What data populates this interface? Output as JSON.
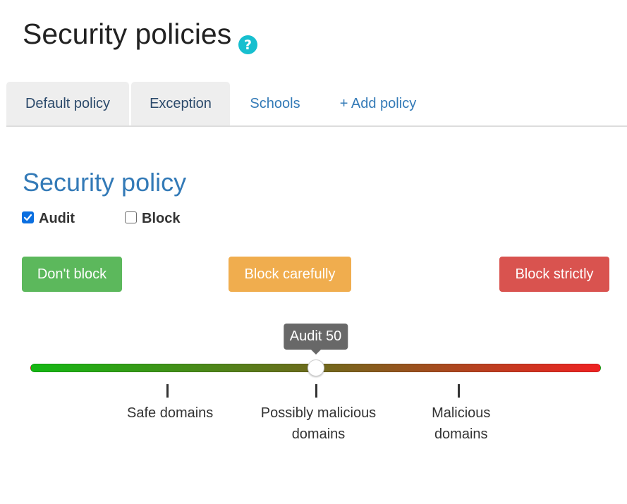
{
  "header": {
    "title": "Security policies",
    "help_icon": "question-circle-icon"
  },
  "tabs": [
    {
      "label": "Default policy",
      "state": "inactive"
    },
    {
      "label": "Exception",
      "state": "active"
    },
    {
      "label": "Schools",
      "state": "link"
    },
    {
      "label": "+ Add policy",
      "state": "link"
    }
  ],
  "policy": {
    "title": "Security policy",
    "options": [
      {
        "label": "Audit",
        "checked": true
      },
      {
        "label": "Block",
        "checked": false
      }
    ]
  },
  "buttons": {
    "dont_block": "Don't block",
    "block_carefully": "Block carefully",
    "block_strictly": "Block strictly"
  },
  "slider": {
    "tooltip": "Audit 50",
    "value": 50,
    "min": 0,
    "max": 100,
    "ticks": [
      {
        "value": 24,
        "line1": "Safe domains",
        "line2": ""
      },
      {
        "value": 50,
        "line1": "Possibly malicious",
        "line2": "domains"
      },
      {
        "value": 75,
        "line1": "Malicious",
        "line2": "domains"
      }
    ]
  },
  "colors": {
    "link": "#337ab7",
    "tab_bg": "#eeeeee",
    "green": "#5cb85c",
    "orange": "#f0ad4e",
    "red": "#d9534f",
    "tooltip_bg": "#686868",
    "help_icon": "#17bfcf",
    "checkbox": "#0b6fe0",
    "track_start": "#14b814",
    "track_mid": "#6e6a1c",
    "track_end": "#ef2222"
  }
}
